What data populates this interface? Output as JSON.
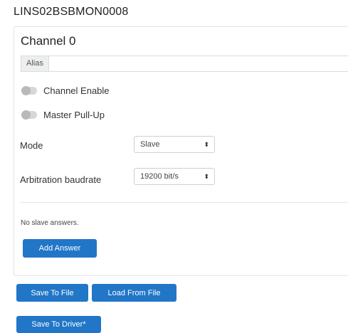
{
  "device": {
    "title": "LINS02BSBMON0008"
  },
  "channel": {
    "title": "Channel 0",
    "alias": {
      "label": "Alias",
      "value": "",
      "placeholder": ""
    },
    "toggles": {
      "channel_enable": {
        "label": "Channel Enable",
        "on": false
      },
      "master_pullup": {
        "label": "Master Pull-Up",
        "on": false
      }
    },
    "mode": {
      "label": "Mode",
      "selected": "Slave"
    },
    "arbitration": {
      "label": "Arbitration baudrate",
      "selected": "19200 bit/s"
    },
    "answers": {
      "empty_text": "No slave answers.",
      "add_label": "Add Answer"
    }
  },
  "actions": {
    "save_file": "Save To File",
    "load_file": "Load From File",
    "save_driver": "Save To Driver*"
  },
  "colors": {
    "primary": "#2176c7",
    "toggle_off": "#d7d7d7"
  },
  "icons": {
    "select_caret": "⬍"
  }
}
